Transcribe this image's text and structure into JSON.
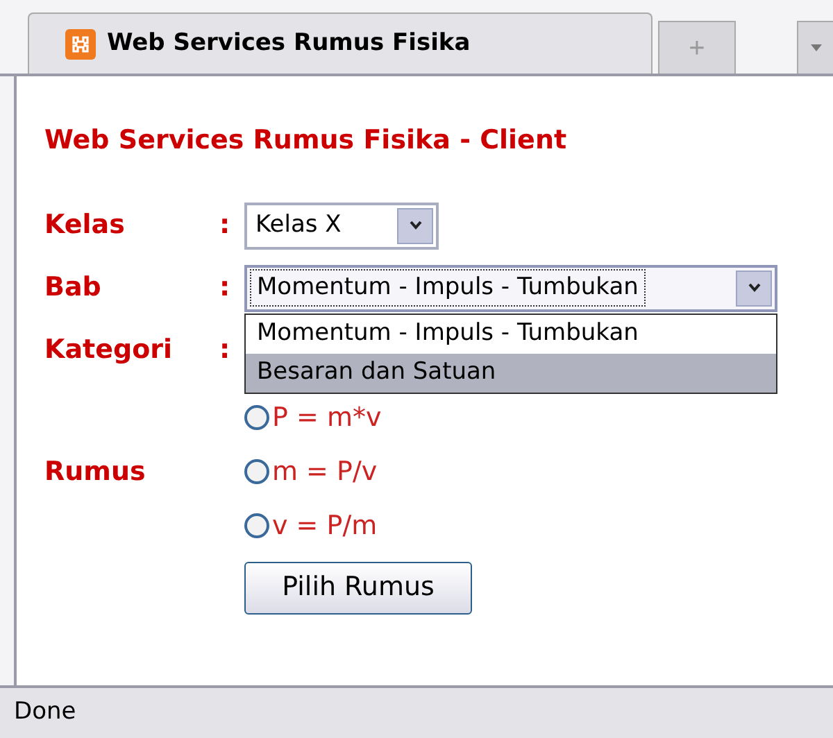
{
  "tab": {
    "title": "Web Services Rumus Fisika",
    "selected": true
  },
  "new_tab": {
    "label": "+"
  },
  "heading": "Web Services Rumus Fisika - Client",
  "form": {
    "kelas": {
      "label": "Kelas",
      "colon": ":",
      "value": "Kelas X"
    },
    "bab": {
      "label": "Bab",
      "colon": ":",
      "value": "Momentum - Impuls - Tumbukan",
      "expanded": true,
      "options": [
        {
          "label": "Momentum - Impuls - Tumbukan",
          "highlighted": false
        },
        {
          "label": "Besaran dan Satuan",
          "highlighted": true
        }
      ]
    },
    "kategori": {
      "label": "Kategori",
      "colon": ":"
    },
    "rumus": {
      "label": "Rumus",
      "options": [
        {
          "label": "P = m*v",
          "selected": false
        },
        {
          "label": "m = P/v",
          "selected": false
        },
        {
          "label": "v = P/m",
          "selected": false
        }
      ]
    },
    "submit": "Pilih Rumus"
  },
  "status_bar": {
    "text": "Done"
  }
}
